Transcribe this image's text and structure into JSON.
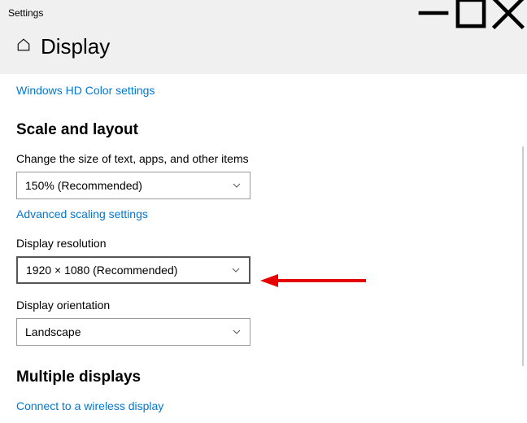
{
  "window": {
    "title": "Settings"
  },
  "page": {
    "title": "Display"
  },
  "links": {
    "hd_color": "Windows HD Color settings",
    "advanced_scaling": "Advanced scaling settings",
    "wireless_display": "Connect to a wireless display"
  },
  "sections": {
    "scale_layout": "Scale and layout",
    "multiple_displays": "Multiple displays"
  },
  "fields": {
    "scale": {
      "label": "Change the size of text, apps, and other items",
      "value": "150% (Recommended)"
    },
    "resolution": {
      "label": "Display resolution",
      "value": "1920 × 1080 (Recommended)"
    },
    "orientation": {
      "label": "Display orientation",
      "value": "Landscape"
    }
  }
}
